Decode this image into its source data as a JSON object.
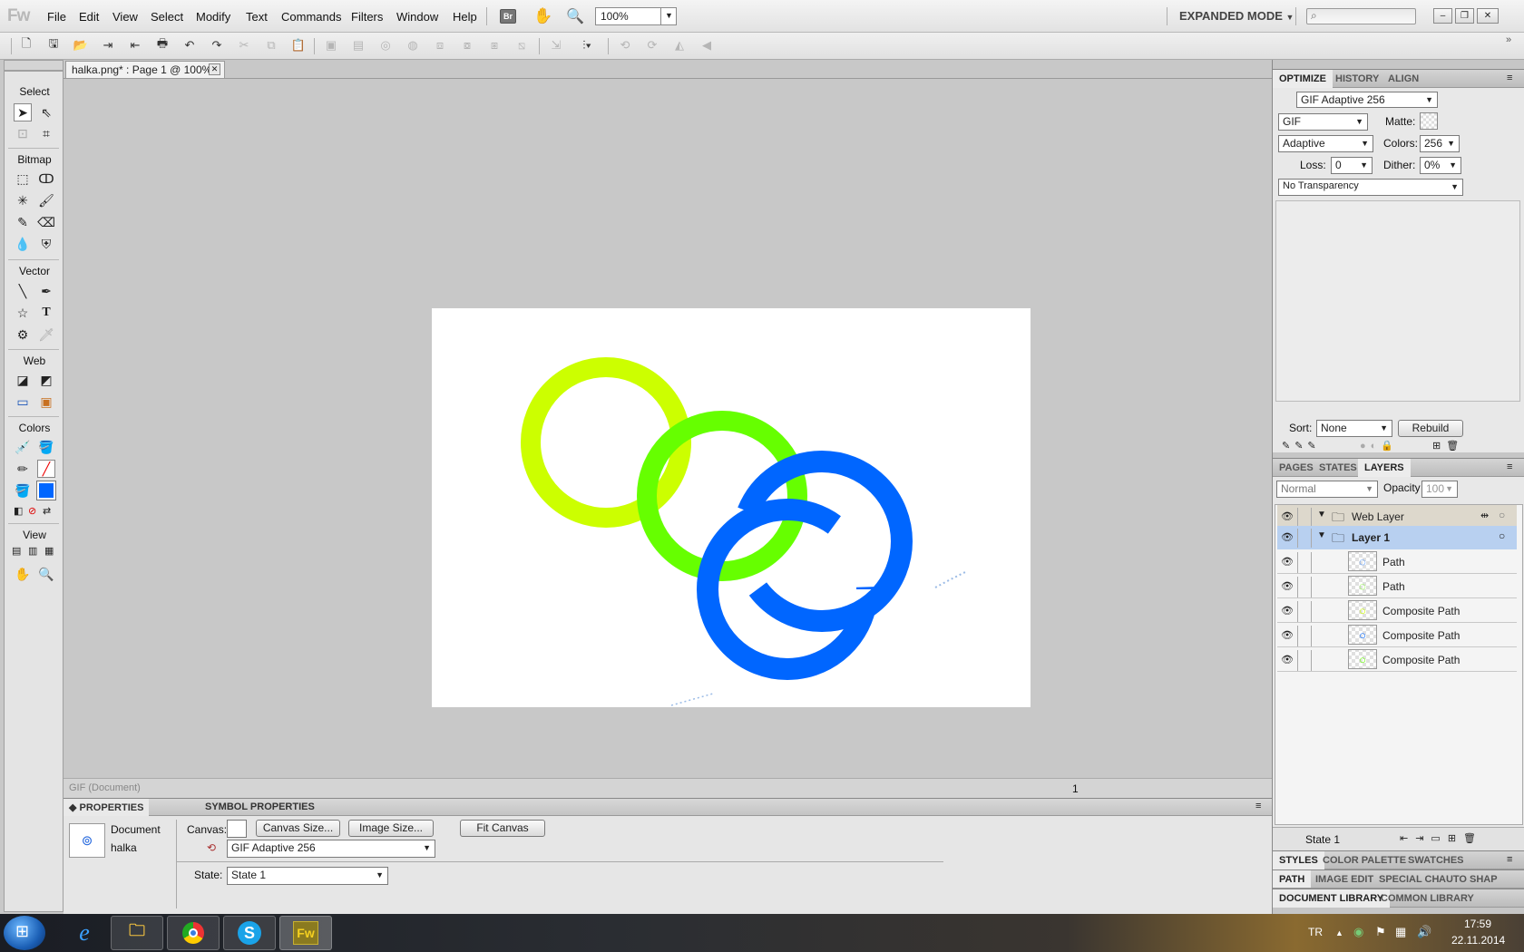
{
  "app": {
    "logo": "Fw",
    "mode": "EXPANDED MODE",
    "zoom": "100%",
    "br_label": "Br"
  },
  "menu": [
    "File",
    "Edit",
    "View",
    "Select",
    "Modify",
    "Text",
    "Commands",
    "Filters",
    "Window",
    "Help"
  ],
  "document": {
    "tab_title": "halka.png* : Page 1 @ 100%",
    "status": "GIF (Document)",
    "page_number": "1"
  },
  "tools": {
    "sections": {
      "select": "Select",
      "bitmap": "Bitmap",
      "vector": "Vector",
      "web": "Web",
      "colors": "Colors",
      "view": "View"
    }
  },
  "properties": {
    "tabs": [
      "PROPERTIES",
      "SYMBOL PROPERTIES"
    ],
    "doc_type": "Document",
    "doc_name": "halka",
    "canvas_label": "Canvas:",
    "canvas_size_btn": "Canvas Size...",
    "image_size_btn": "Image Size...",
    "fit_canvas_btn": "Fit Canvas",
    "format_select": "GIF Adaptive 256",
    "state_label": "State:",
    "state_select": "State 1"
  },
  "optimize": {
    "tabs": [
      "OPTIMIZE",
      "HISTORY",
      "ALIGN"
    ],
    "preset": "GIF Adaptive 256",
    "format": "GIF",
    "matte_label": "Matte:",
    "palette": "Adaptive",
    "colors_label": "Colors:",
    "colors": "256",
    "loss_label": "Loss:",
    "loss": "0",
    "dither_label": "Dither:",
    "dither": "0%",
    "transparency": "No Transparency",
    "sort_label": "Sort:",
    "sort": "None",
    "rebuild_btn": "Rebuild"
  },
  "layers": {
    "tabs": [
      "PAGES",
      "STATES",
      "LAYERS"
    ],
    "blend": "Normal",
    "opacity_label": "Opacity",
    "opacity": "100",
    "rows": [
      {
        "name": "Web Layer",
        "kind": "folder"
      },
      {
        "name": "Layer 1",
        "kind": "folder"
      },
      {
        "name": "Path",
        "kind": "object",
        "thumb_color": "#0066ff"
      },
      {
        "name": "Path",
        "kind": "object",
        "thumb_color": "#66ff00"
      },
      {
        "name": "Composite Path",
        "kind": "object",
        "thumb_color": "#ccff00"
      },
      {
        "name": "Composite Path",
        "kind": "object",
        "thumb_color": "#0066ff"
      },
      {
        "name": "Composite Path",
        "kind": "object",
        "thumb_color": "#66ff00"
      }
    ],
    "state": "State 1"
  },
  "bottom_panels": {
    "row1": [
      "STYLES",
      "COLOR PALETTE",
      "SWATCHES"
    ],
    "row2": [
      "PATH",
      "IMAGE EDIT",
      "SPECIAL CH",
      "AUTO SHAP"
    ],
    "row3": [
      "DOCUMENT LIBRARY",
      "COMMON LIBRARY"
    ]
  },
  "taskbar": {
    "lang": "TR",
    "time": "17:59",
    "date": "22.11.2014",
    "fw_label": "Fw"
  },
  "colors": {
    "yellow_ring": "#ccff00",
    "green_ring": "#66ff00",
    "blue_ring": "#0066ff",
    "fill_swatch": "#0066ff"
  }
}
